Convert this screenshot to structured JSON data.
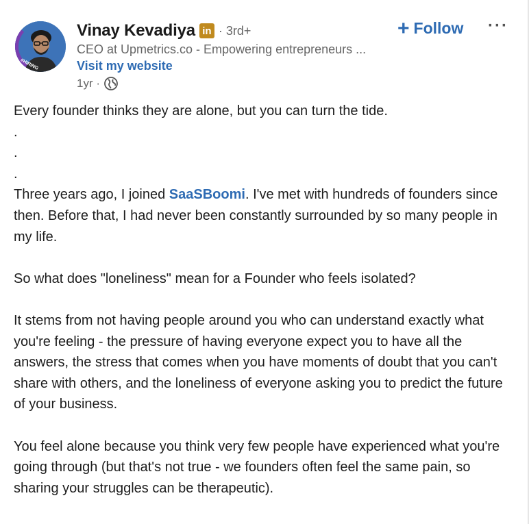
{
  "author": {
    "name": "Vinay Kevadiya",
    "badge_icon": "linkedin-icon",
    "badge_text": "in",
    "degree": "· 3rd+",
    "headline": "CEO at Upmetrics.co - Empowering entrepreneurs ...",
    "website_label": "Visit my website",
    "time": "1yr ·",
    "avatar_badge": "#HIRING"
  },
  "actions": {
    "follow_label": "Follow",
    "follow_icon": "+",
    "more_label": "···"
  },
  "post": {
    "line1": "Every founder thinks they are alone, but you can turn the tide.",
    "dot1": ".",
    "dot2": ".",
    "dot3": ".",
    "para2_before": "Three years ago, I joined ",
    "mention": "SaaSBoomi",
    "para2_after": ". I've met with hundreds of founders since then. Before that, I had never been constantly surrounded by so many people in my life.",
    "para3": "So what does \"loneliness\" mean for a Founder who feels isolated?",
    "para4": "It stems from not having people around you who can understand exactly what you're feeling - the pressure of having everyone expect you to have all the answers, the stress that comes when you have moments of doubt that you can't share with others, and the loneliness of everyone asking you to predict the future of your business.",
    "para5": "You feel alone because you think very few people have experienced what you're going through (but that's not true - we founders often feel the same pain, so sharing your struggles can be therapeutic)."
  },
  "colors": {
    "link": "#2e6bb3",
    "badge": "#c08a1e",
    "avatar_bg": "#3d73b8",
    "hiring_ring": "#7a3fb0"
  }
}
